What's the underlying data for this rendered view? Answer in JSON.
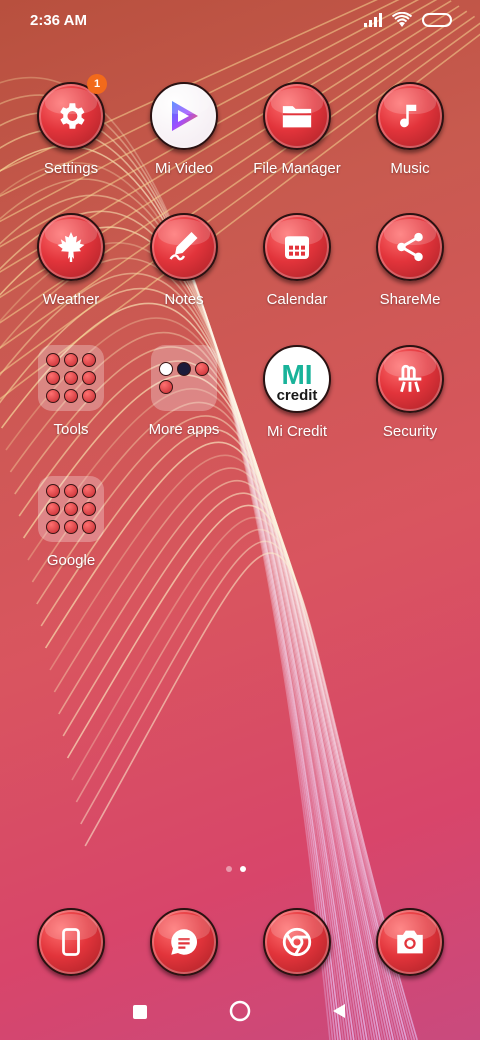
{
  "status": {
    "time": "2:36 AM"
  },
  "apps": {
    "settings": {
      "label": "Settings",
      "badge": "1"
    },
    "mi_video": {
      "label": "Mi Video"
    },
    "file_manager": {
      "label": "File Manager"
    },
    "music": {
      "label": "Music"
    },
    "weather": {
      "label": "Weather"
    },
    "notes": {
      "label": "Notes"
    },
    "calendar": {
      "label": "Calendar"
    },
    "shareme": {
      "label": "ShareMe"
    },
    "tools": {
      "label": "Tools"
    },
    "more_apps": {
      "label": "More apps"
    },
    "mi_credit": {
      "label": "Mi Credit",
      "logo_text": "MI",
      "logo_sub": "credit"
    },
    "security": {
      "label": "Security"
    },
    "google": {
      "label": "Google"
    }
  },
  "dock": [
    "phone-icon",
    "messages-icon",
    "chrome-icon",
    "camera-icon"
  ],
  "pager": {
    "pages": 2,
    "current": 2
  },
  "colors": {
    "accent": "#e2343b",
    "badge": "#f26a1b",
    "credit_green": "#19b39a"
  }
}
